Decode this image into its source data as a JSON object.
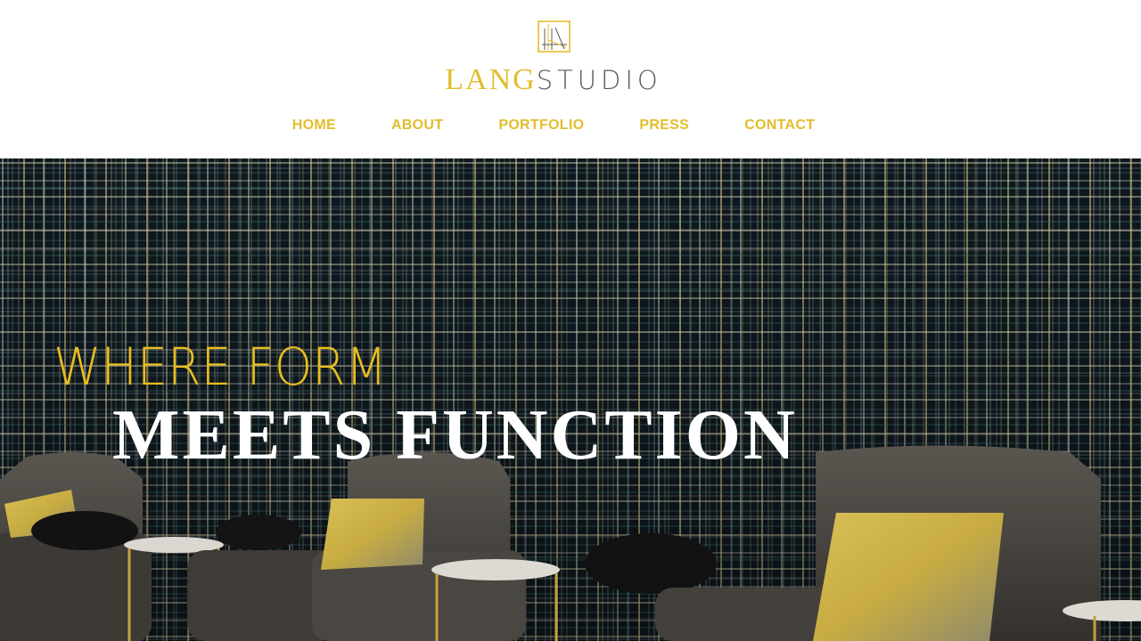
{
  "brand": {
    "name_primary": "LANG",
    "name_secondary": "STUDIO",
    "logo_icon": "architectural-frame-logo-icon",
    "accent_color": "#e2bd2c",
    "secondary_color": "#5a5a5a"
  },
  "nav": {
    "items": [
      {
        "label": "HOME"
      },
      {
        "label": "ABOUT"
      },
      {
        "label": "PORTFOLIO"
      },
      {
        "label": "PRESS"
      },
      {
        "label": "CONTACT"
      }
    ]
  },
  "hero": {
    "headline_line1": "WHERE FORM",
    "headline_line2": "MEETS FUNCTION",
    "line1_color": "#e8bd1f",
    "line2_color": "#ffffff"
  }
}
